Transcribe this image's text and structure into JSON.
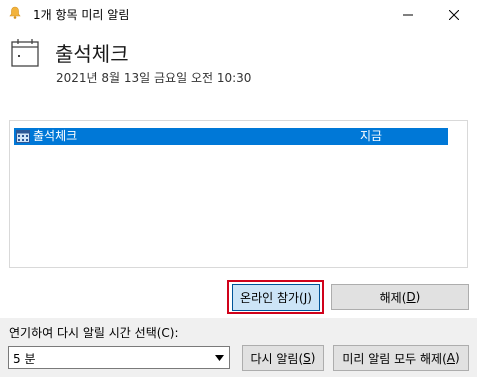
{
  "window": {
    "title": "1개 항목 미리 알림",
    "icon": "bell-icon"
  },
  "reminder": {
    "icon": "calendar-icon",
    "subject": "출석체크",
    "datetime": "2021년 8월 13일 금요일 오전 10:30"
  },
  "list": {
    "items": [
      {
        "icon": "calendar-small-icon",
        "subject": "출석체크",
        "due": "지금",
        "selected": true
      }
    ]
  },
  "buttons": {
    "join_prefix": "온라인 참가(",
    "join_key": "J",
    "join_suffix": ")",
    "dismiss_prefix": "해제(",
    "dismiss_key": "D",
    "dismiss_suffix": ")",
    "snooze_prefix": "다시 알림(",
    "snooze_key": "S",
    "snooze_suffix": ")",
    "dismiss_all_prefix": "미리 알림 모두 해제(",
    "dismiss_all_key": "A",
    "dismiss_all_suffix": ")"
  },
  "snooze": {
    "label": "연기하여 다시 알릴 시간 선택(C):",
    "selected": "5 분"
  },
  "colors": {
    "selection": "#0078d7",
    "highlight_box": "#d0021b",
    "focused_button": "#cce4f7"
  }
}
